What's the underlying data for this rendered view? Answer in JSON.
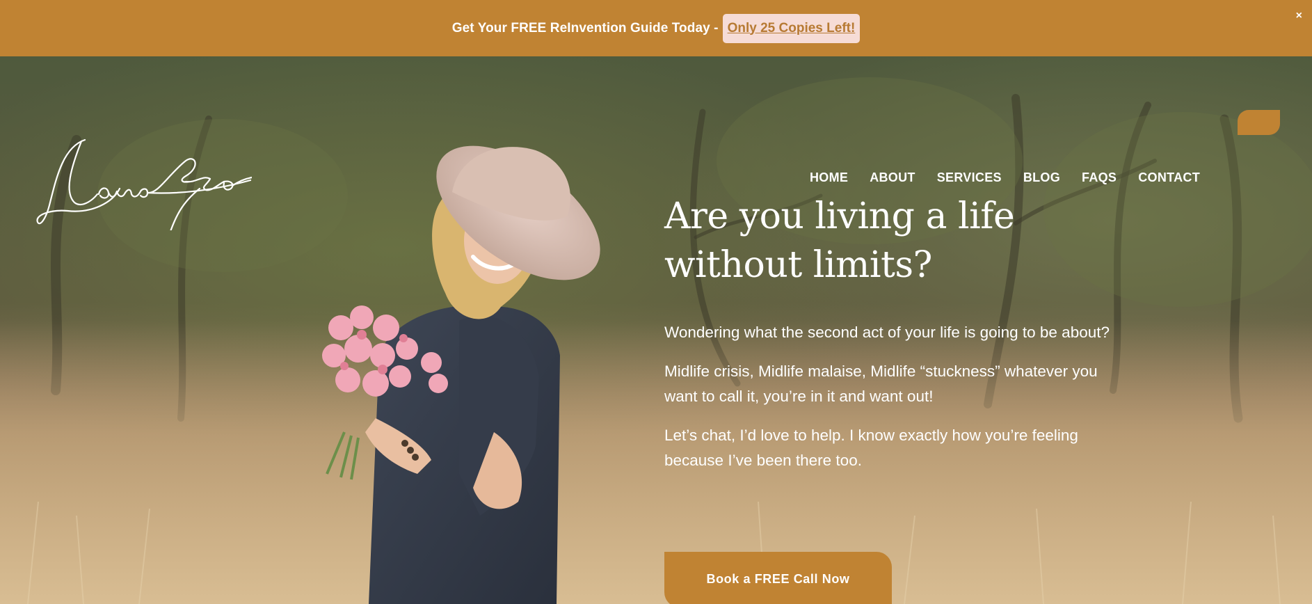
{
  "announcement": {
    "text": "Get Your FREE ReInvention Guide Today -",
    "link_label": "Only 25 Copies Left!",
    "close_label": "×"
  },
  "logo": {
    "text": "Laura Enzor"
  },
  "nav": {
    "items": [
      "HOME",
      "ABOUT",
      "SERVICES",
      "BLOG",
      "FAQS",
      "CONTACT"
    ]
  },
  "hero": {
    "headline": "Are you living a life without limits?",
    "paragraphs": [
      "Wondering what the second act of your life is going to be about?",
      "Midlife crisis, Midlife malaise, Midlife “stuckness” whatever you want to call it, you’re in it and want out!",
      "Let’s chat, I’d love to help. I know exactly how you’re feeling because I’ve been there too."
    ],
    "cta_label": "Book a FREE Call Now"
  },
  "colors": {
    "accent": "#c08333",
    "link_bg": "#f6dcd6",
    "text": "#ffffff"
  }
}
